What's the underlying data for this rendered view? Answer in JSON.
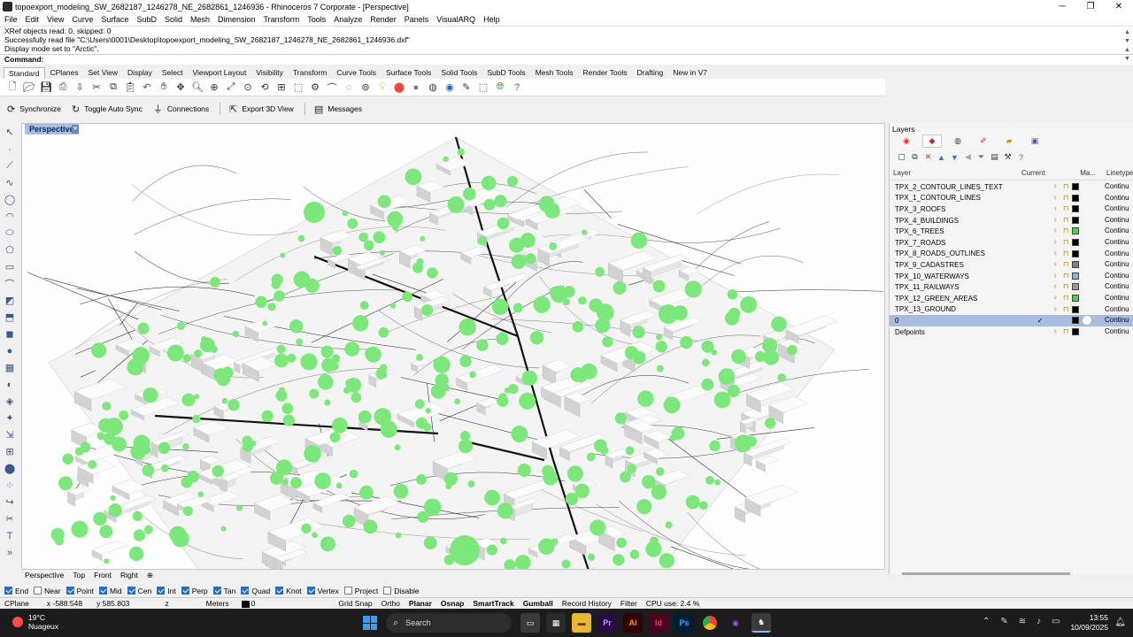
{
  "window": {
    "title": "topoexport_modeling_SW_2682187_1246278_NE_2682861_1246936 - Rhinoceros 7 Corporate - [Perspective]",
    "buttons": [
      "─",
      "❐",
      "✕"
    ]
  },
  "menu": [
    "File",
    "Edit",
    "View",
    "Curve",
    "Surface",
    "SubD",
    "Solid",
    "Mesh",
    "Dimension",
    "Transform",
    "Tools",
    "Analyze",
    "Render",
    "Panels",
    "VisualARQ",
    "Help"
  ],
  "command_history": [
    "XRef objects read: 0, skipped: 0",
    "Successfully read file \"C:\\Users\\0001\\Desktop\\topoexport_modeling_SW_2682187_1246278_NE_2682861_1246936.dxf\"",
    "Display mode set to \"Arctic\"."
  ],
  "command_prompt": "Command:",
  "toolbar_tabs": [
    "Standard",
    "CPlanes",
    "Set View",
    "Display",
    "Select",
    "Viewport Layout",
    "Visibility",
    "Transform",
    "Curve Tools",
    "Surface Tools",
    "Solid Tools",
    "SubD Tools",
    "Mesh Tools",
    "Render Tools",
    "Drafting",
    "New in V7"
  ],
  "standard_icons": [
    "new-file",
    "open-file",
    "save",
    "print",
    "import",
    "cut",
    "copy",
    "paste",
    "undo",
    "pan",
    "rotate-view",
    "zoom",
    "zoom-window",
    "zoom-extents",
    "zoom-selected",
    "undo-view",
    "four-viewports",
    "cplane",
    "object-properties",
    "hide-objects",
    "lock-objects",
    "show-objects",
    "layer",
    "color-wheel",
    "render-sphere",
    "render-sphere-dark",
    "material-sphere",
    "wand",
    "select-tool",
    "rendering",
    "help"
  ],
  "sync_bar": {
    "synchronize": "Synchronize",
    "toggle_auto_sync": "Toggle Auto Sync",
    "connections": "Connections",
    "export_3d_view": "Export 3D View",
    "messages": "Messages"
  },
  "viewport": {
    "label": "Perspective",
    "tabs": [
      "Perspective",
      "Top",
      "Front",
      "Right",
      "⊕"
    ]
  },
  "osnaps": [
    {
      "label": "End",
      "on": true
    },
    {
      "label": "Near",
      "on": false
    },
    {
      "label": "Point",
      "on": true
    },
    {
      "label": "Mid",
      "on": true
    },
    {
      "label": "Cen",
      "on": true
    },
    {
      "label": "Int",
      "on": true
    },
    {
      "label": "Perp",
      "on": true
    },
    {
      "label": "Tan",
      "on": true
    },
    {
      "label": "Quad",
      "on": true
    },
    {
      "label": "Knot",
      "on": true
    },
    {
      "label": "Vertex",
      "on": true
    },
    {
      "label": "Project",
      "on": false
    },
    {
      "label": "Disable",
      "on": false
    }
  ],
  "status": {
    "cplane": "CPlane",
    "x": "x -588.548",
    "y": "y 585.803",
    "z": "z",
    "units": "Meters",
    "layer": "0",
    "toggles": [
      "Grid Snap",
      "Ortho",
      "Planar",
      "Osnap",
      "SmartTrack",
      "Gumball",
      "Record History",
      "Filter"
    ],
    "cpu": "CPU use: 2.4 %"
  },
  "layers_panel": {
    "title": "Layers",
    "columns": {
      "name": "Layer",
      "current": "Current",
      "material": "Ma...",
      "linetype": "Linetype"
    },
    "rows": [
      {
        "name": "TPX_2_CONTOUR_LINES_TEXT",
        "color": "#000000",
        "current": false,
        "linetype": "Continu"
      },
      {
        "name": "TPX_1_CONTOUR_LINES",
        "color": "#000000",
        "current": false,
        "linetype": "Continu"
      },
      {
        "name": "TPX_3_ROOFS",
        "color": "#000000",
        "current": false,
        "linetype": "Continu"
      },
      {
        "name": "TPX_4_BUILDINGS",
        "color": "#000000",
        "current": false,
        "linetype": "Continu"
      },
      {
        "name": "TPX_6_TREES",
        "color": "#3ddc3d",
        "current": false,
        "linetype": "Continu"
      },
      {
        "name": "TPX_7_ROADS",
        "color": "#000000",
        "current": false,
        "linetype": "Continu"
      },
      {
        "name": "TPX_8_ROADS_OUTLINES",
        "color": "#000000",
        "current": false,
        "linetype": "Continu"
      },
      {
        "name": "TPX_9_CADASTRES",
        "color": "#7f7f7f",
        "current": false,
        "linetype": "Continu"
      },
      {
        "name": "TPX_10_WATERWAYS",
        "color": "#8fb4e0",
        "current": false,
        "linetype": "Continu"
      },
      {
        "name": "TPX_11_RAILWAYS",
        "color": "#9a9a9a",
        "current": false,
        "linetype": "Continu"
      },
      {
        "name": "TPX_12_GREEN_AREAS",
        "color": "#4fd04f",
        "current": false,
        "linetype": "Continu"
      },
      {
        "name": "TPX_13_GROUND",
        "color": "#000000",
        "current": false,
        "linetype": "Continu"
      },
      {
        "name": "0",
        "color": "#000000",
        "current": true,
        "linetype": "Continu"
      },
      {
        "name": "Defpoints",
        "color": "#000000",
        "current": false,
        "linetype": "Continu"
      }
    ]
  },
  "taskbar": {
    "temperature": "19°C",
    "weather": "Nuageux",
    "search": "Search",
    "time": "13:55",
    "date": "10/09/2025",
    "apps": [
      "Pr",
      "Ai",
      "Id",
      "Ps"
    ]
  },
  "colors": {
    "tree_green": "#7ce87c",
    "selection": "#a9bce0",
    "viewport_label": "#0b2a66"
  }
}
